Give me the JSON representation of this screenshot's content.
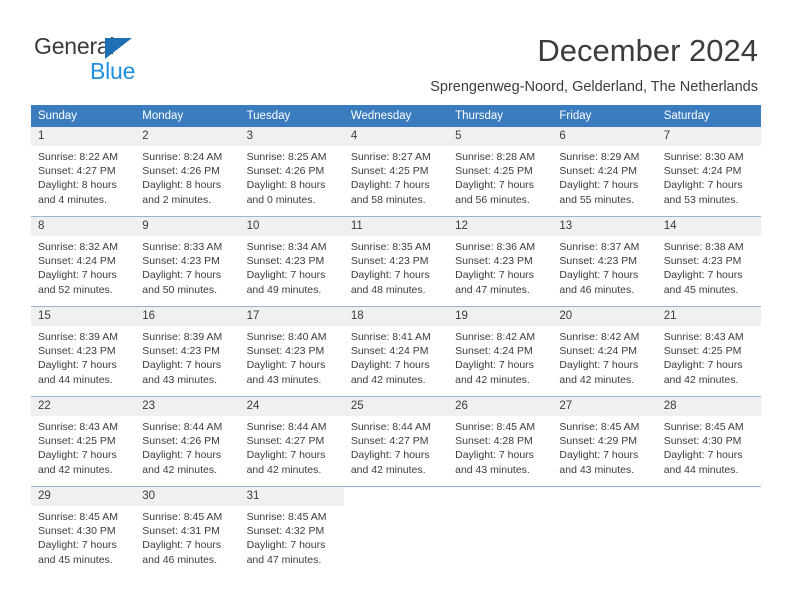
{
  "brand": {
    "name_top": "General",
    "name_bottom": "Blue",
    "triangle_color": "#1f6fb5",
    "blue_color": "#1f8fe0"
  },
  "header": {
    "title": "December 2024",
    "subtitle": "Sprengenweg-Noord, Gelderland, The Netherlands",
    "header_bg": "#3b7cbf",
    "daynum_bg": "#f0f0f0"
  },
  "weekday_headers": [
    "Sunday",
    "Monday",
    "Tuesday",
    "Wednesday",
    "Thursday",
    "Friday",
    "Saturday"
  ],
  "weeks": [
    [
      {
        "day": "1",
        "sunrise": "Sunrise: 8:22 AM",
        "sunset": "Sunset: 4:27 PM",
        "daylight_line1": "Daylight: 8 hours",
        "daylight_line2": "and 4 minutes."
      },
      {
        "day": "2",
        "sunrise": "Sunrise: 8:24 AM",
        "sunset": "Sunset: 4:26 PM",
        "daylight_line1": "Daylight: 8 hours",
        "daylight_line2": "and 2 minutes."
      },
      {
        "day": "3",
        "sunrise": "Sunrise: 8:25 AM",
        "sunset": "Sunset: 4:26 PM",
        "daylight_line1": "Daylight: 8 hours",
        "daylight_line2": "and 0 minutes."
      },
      {
        "day": "4",
        "sunrise": "Sunrise: 8:27 AM",
        "sunset": "Sunset: 4:25 PM",
        "daylight_line1": "Daylight: 7 hours",
        "daylight_line2": "and 58 minutes."
      },
      {
        "day": "5",
        "sunrise": "Sunrise: 8:28 AM",
        "sunset": "Sunset: 4:25 PM",
        "daylight_line1": "Daylight: 7 hours",
        "daylight_line2": "and 56 minutes."
      },
      {
        "day": "6",
        "sunrise": "Sunrise: 8:29 AM",
        "sunset": "Sunset: 4:24 PM",
        "daylight_line1": "Daylight: 7 hours",
        "daylight_line2": "and 55 minutes."
      },
      {
        "day": "7",
        "sunrise": "Sunrise: 8:30 AM",
        "sunset": "Sunset: 4:24 PM",
        "daylight_line1": "Daylight: 7 hours",
        "daylight_line2": "and 53 minutes."
      }
    ],
    [
      {
        "day": "8",
        "sunrise": "Sunrise: 8:32 AM",
        "sunset": "Sunset: 4:24 PM",
        "daylight_line1": "Daylight: 7 hours",
        "daylight_line2": "and 52 minutes."
      },
      {
        "day": "9",
        "sunrise": "Sunrise: 8:33 AM",
        "sunset": "Sunset: 4:23 PM",
        "daylight_line1": "Daylight: 7 hours",
        "daylight_line2": "and 50 minutes."
      },
      {
        "day": "10",
        "sunrise": "Sunrise: 8:34 AM",
        "sunset": "Sunset: 4:23 PM",
        "daylight_line1": "Daylight: 7 hours",
        "daylight_line2": "and 49 minutes."
      },
      {
        "day": "11",
        "sunrise": "Sunrise: 8:35 AM",
        "sunset": "Sunset: 4:23 PM",
        "daylight_line1": "Daylight: 7 hours",
        "daylight_line2": "and 48 minutes."
      },
      {
        "day": "12",
        "sunrise": "Sunrise: 8:36 AM",
        "sunset": "Sunset: 4:23 PM",
        "daylight_line1": "Daylight: 7 hours",
        "daylight_line2": "and 47 minutes."
      },
      {
        "day": "13",
        "sunrise": "Sunrise: 8:37 AM",
        "sunset": "Sunset: 4:23 PM",
        "daylight_line1": "Daylight: 7 hours",
        "daylight_line2": "and 46 minutes."
      },
      {
        "day": "14",
        "sunrise": "Sunrise: 8:38 AM",
        "sunset": "Sunset: 4:23 PM",
        "daylight_line1": "Daylight: 7 hours",
        "daylight_line2": "and 45 minutes."
      }
    ],
    [
      {
        "day": "15",
        "sunrise": "Sunrise: 8:39 AM",
        "sunset": "Sunset: 4:23 PM",
        "daylight_line1": "Daylight: 7 hours",
        "daylight_line2": "and 44 minutes."
      },
      {
        "day": "16",
        "sunrise": "Sunrise: 8:39 AM",
        "sunset": "Sunset: 4:23 PM",
        "daylight_line1": "Daylight: 7 hours",
        "daylight_line2": "and 43 minutes."
      },
      {
        "day": "17",
        "sunrise": "Sunrise: 8:40 AM",
        "sunset": "Sunset: 4:23 PM",
        "daylight_line1": "Daylight: 7 hours",
        "daylight_line2": "and 43 minutes."
      },
      {
        "day": "18",
        "sunrise": "Sunrise: 8:41 AM",
        "sunset": "Sunset: 4:24 PM",
        "daylight_line1": "Daylight: 7 hours",
        "daylight_line2": "and 42 minutes."
      },
      {
        "day": "19",
        "sunrise": "Sunrise: 8:42 AM",
        "sunset": "Sunset: 4:24 PM",
        "daylight_line1": "Daylight: 7 hours",
        "daylight_line2": "and 42 minutes."
      },
      {
        "day": "20",
        "sunrise": "Sunrise: 8:42 AM",
        "sunset": "Sunset: 4:24 PM",
        "daylight_line1": "Daylight: 7 hours",
        "daylight_line2": "and 42 minutes."
      },
      {
        "day": "21",
        "sunrise": "Sunrise: 8:43 AM",
        "sunset": "Sunset: 4:25 PM",
        "daylight_line1": "Daylight: 7 hours",
        "daylight_line2": "and 42 minutes."
      }
    ],
    [
      {
        "day": "22",
        "sunrise": "Sunrise: 8:43 AM",
        "sunset": "Sunset: 4:25 PM",
        "daylight_line1": "Daylight: 7 hours",
        "daylight_line2": "and 42 minutes."
      },
      {
        "day": "23",
        "sunrise": "Sunrise: 8:44 AM",
        "sunset": "Sunset: 4:26 PM",
        "daylight_line1": "Daylight: 7 hours",
        "daylight_line2": "and 42 minutes."
      },
      {
        "day": "24",
        "sunrise": "Sunrise: 8:44 AM",
        "sunset": "Sunset: 4:27 PM",
        "daylight_line1": "Daylight: 7 hours",
        "daylight_line2": "and 42 minutes."
      },
      {
        "day": "25",
        "sunrise": "Sunrise: 8:44 AM",
        "sunset": "Sunset: 4:27 PM",
        "daylight_line1": "Daylight: 7 hours",
        "daylight_line2": "and 42 minutes."
      },
      {
        "day": "26",
        "sunrise": "Sunrise: 8:45 AM",
        "sunset": "Sunset: 4:28 PM",
        "daylight_line1": "Daylight: 7 hours",
        "daylight_line2": "and 43 minutes."
      },
      {
        "day": "27",
        "sunrise": "Sunrise: 8:45 AM",
        "sunset": "Sunset: 4:29 PM",
        "daylight_line1": "Daylight: 7 hours",
        "daylight_line2": "and 43 minutes."
      },
      {
        "day": "28",
        "sunrise": "Sunrise: 8:45 AM",
        "sunset": "Sunset: 4:30 PM",
        "daylight_line1": "Daylight: 7 hours",
        "daylight_line2": "and 44 minutes."
      }
    ],
    [
      {
        "day": "29",
        "sunrise": "Sunrise: 8:45 AM",
        "sunset": "Sunset: 4:30 PM",
        "daylight_line1": "Daylight: 7 hours",
        "daylight_line2": "and 45 minutes."
      },
      {
        "day": "30",
        "sunrise": "Sunrise: 8:45 AM",
        "sunset": "Sunset: 4:31 PM",
        "daylight_line1": "Daylight: 7 hours",
        "daylight_line2": "and 46 minutes."
      },
      {
        "day": "31",
        "sunrise": "Sunrise: 8:45 AM",
        "sunset": "Sunset: 4:32 PM",
        "daylight_line1": "Daylight: 7 hours",
        "daylight_line2": "and 47 minutes."
      },
      {
        "day": "",
        "sunrise": "",
        "sunset": "",
        "daylight_line1": "",
        "daylight_line2": ""
      },
      {
        "day": "",
        "sunrise": "",
        "sunset": "",
        "daylight_line1": "",
        "daylight_line2": ""
      },
      {
        "day": "",
        "sunrise": "",
        "sunset": "",
        "daylight_line1": "",
        "daylight_line2": ""
      },
      {
        "day": "",
        "sunrise": "",
        "sunset": "",
        "daylight_line1": "",
        "daylight_line2": ""
      }
    ]
  ]
}
